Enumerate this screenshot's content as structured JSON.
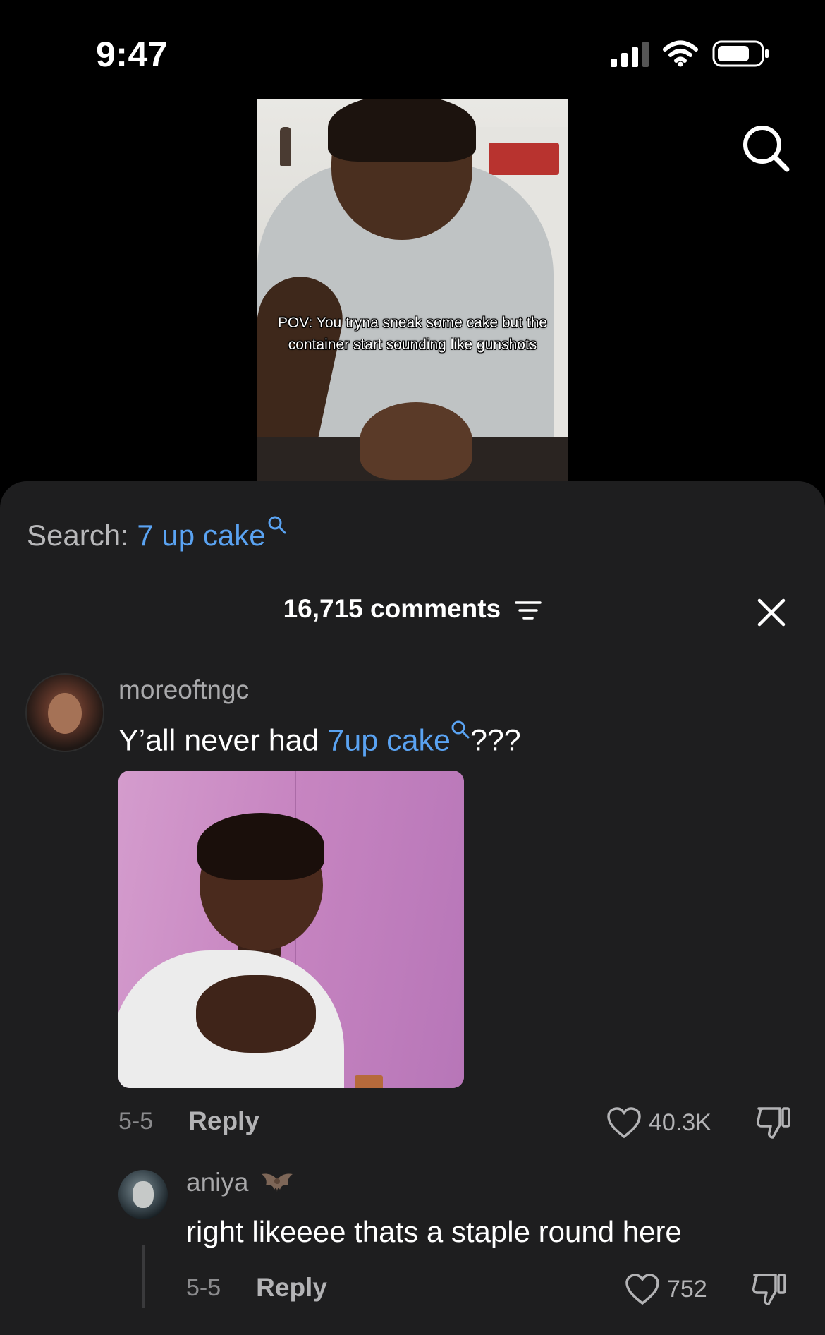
{
  "status_bar": {
    "time": "9:47"
  },
  "video": {
    "caption": "POV: You tryna sneak some cake but the container start sounding like gunshots"
  },
  "search": {
    "prefix": "Search:",
    "keyword": "7 up cake"
  },
  "comments_header": {
    "count_label": "16,715 comments"
  },
  "comment": {
    "username": "moreoftngc",
    "text_before": "Y’all never had ",
    "keyword": "7up cake",
    "text_after": "???",
    "date": "5-5",
    "reply_label": "Reply",
    "likes": "40.3K"
  },
  "reply": {
    "username": "aniya",
    "text": "right likeeee thats a staple round here",
    "date": "5-5",
    "reply_label": "Reply",
    "likes": "752"
  },
  "colors": {
    "link": "#5aa3f2",
    "sheet_bg": "#1e1e1f",
    "muted": "#a9a9ab"
  },
  "icons": [
    "signal-icon",
    "wifi-icon",
    "battery-icon",
    "search-icon",
    "filter-icon",
    "close-icon",
    "heart-icon",
    "dislike-icon",
    "bat-emoji-icon"
  ]
}
